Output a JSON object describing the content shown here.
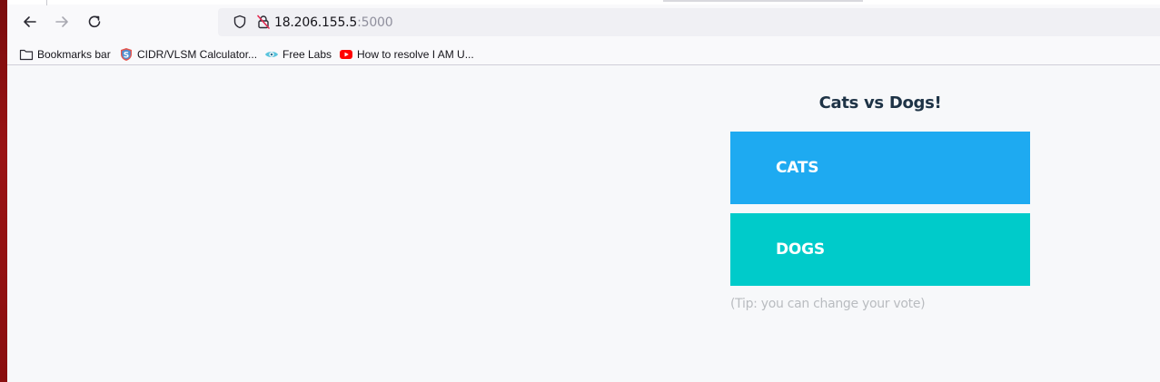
{
  "browser": {
    "url_host": "18.206.155.5",
    "url_port": ":5000",
    "icons": {
      "back": "arrow-left-icon",
      "forward": "arrow-right-icon",
      "reload": "reload-icon",
      "tracking": "shield-icon",
      "security": "insecure-lock-icon"
    }
  },
  "bookmarks": [
    {
      "label": "Bookmarks bar",
      "icon": "folder-icon"
    },
    {
      "label": "CIDR/VLSM Calculator...",
      "icon": "calculator-favicon"
    },
    {
      "label": "Free Labs",
      "icon": "eye-favicon"
    },
    {
      "label": "How to resolve I AM U...",
      "icon": "youtube-favicon"
    }
  ],
  "page": {
    "title": "Cats vs Dogs!",
    "options": [
      {
        "label": "CATS",
        "color": "#1eaaf1"
      },
      {
        "label": "DOGS",
        "color": "#00cbca"
      }
    ],
    "tip": "(Tip: you can change your vote)"
  }
}
